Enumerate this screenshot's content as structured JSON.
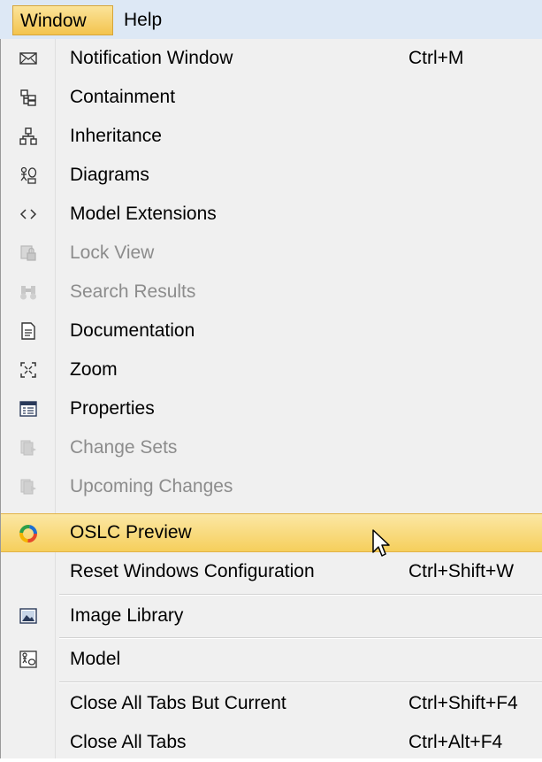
{
  "menubar": {
    "window_label": "Window",
    "help_label": "Help"
  },
  "menu": {
    "items": [
      {
        "label": "Notification Window",
        "shortcut": "Ctrl+M",
        "icon": "notification-icon",
        "enabled": true
      },
      {
        "label": "Containment",
        "shortcut": "",
        "icon": "containment-tree-icon",
        "enabled": true
      },
      {
        "label": "Inheritance",
        "shortcut": "",
        "icon": "inheritance-tree-icon",
        "enabled": true
      },
      {
        "label": "Diagrams",
        "shortcut": "",
        "icon": "diagrams-icon",
        "enabled": true
      },
      {
        "label": "Model Extensions",
        "shortcut": "",
        "icon": "angle-brackets-icon",
        "enabled": true
      },
      {
        "label": "Lock View",
        "shortcut": "",
        "icon": "lock-view-icon",
        "enabled": false
      },
      {
        "label": "Search Results",
        "shortcut": "",
        "icon": "binoculars-icon",
        "enabled": false
      },
      {
        "label": "Documentation",
        "shortcut": "",
        "icon": "document-icon",
        "enabled": true
      },
      {
        "label": "Zoom",
        "shortcut": "",
        "icon": "zoom-icon",
        "enabled": true
      },
      {
        "label": "Properties",
        "shortcut": "",
        "icon": "properties-table-icon",
        "enabled": true
      },
      {
        "label": "Change Sets",
        "shortcut": "",
        "icon": "change-sets-icon",
        "enabled": false
      },
      {
        "label": "Upcoming Changes",
        "shortcut": "",
        "icon": "upcoming-changes-icon",
        "enabled": false
      },
      {
        "label": "OSLC Preview",
        "shortcut": "",
        "icon": "oslc-ring-icon",
        "enabled": true,
        "highlighted": true
      },
      {
        "label": "Reset Windows Configuration",
        "shortcut": "Ctrl+Shift+W",
        "icon": "",
        "enabled": true
      },
      {
        "label": "Image Library",
        "shortcut": "",
        "icon": "image-icon",
        "enabled": true
      },
      {
        "label": "Model",
        "shortcut": "",
        "icon": "model-icon",
        "enabled": true
      },
      {
        "label": "Close All Tabs But Current",
        "shortcut": "Ctrl+Shift+F4",
        "icon": "",
        "enabled": true
      },
      {
        "label": "Close All Tabs",
        "shortcut": "Ctrl+Alt+F4",
        "icon": "",
        "enabled": true
      }
    ]
  },
  "colors": {
    "highlight": "#f6cf5c",
    "menubar_bg": "#dde8f5",
    "disabled_text": "#8c8c8c"
  }
}
